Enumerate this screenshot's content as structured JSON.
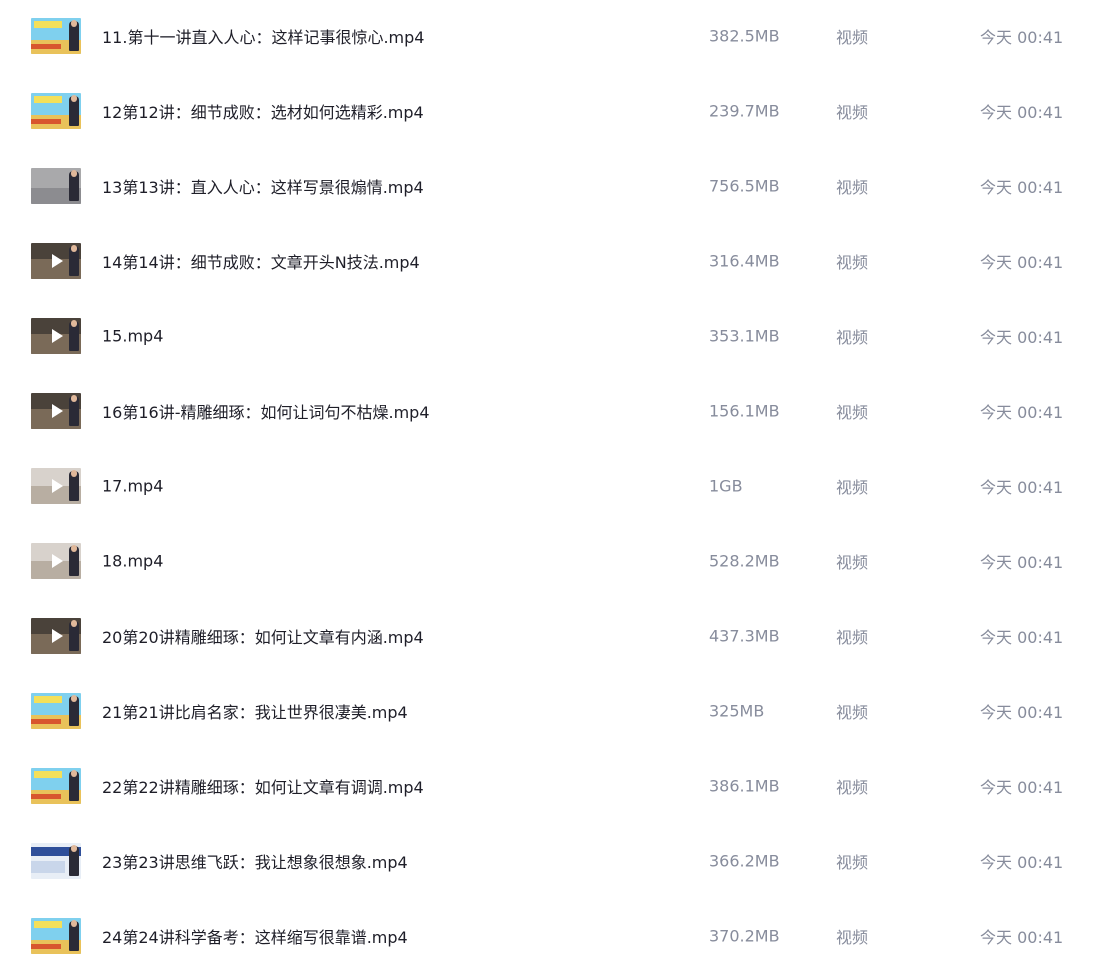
{
  "files": [
    {
      "name": "11.第十一讲直入人心：这样记事很惊心.mp4",
      "size": "382.5MB",
      "type": "视频",
      "time": "今天 00:41",
      "thumb": "cartoon"
    },
    {
      "name": "12第12讲：细节成败：选材如何选精彩.mp4",
      "size": "239.7MB",
      "type": "视频",
      "time": "今天 00:41",
      "thumb": "cartoon"
    },
    {
      "name": "13第13讲：直入人心：这样写景很煽情.mp4",
      "size": "756.5MB",
      "type": "视频",
      "time": "今天 00:41",
      "thumb": "gray"
    },
    {
      "name": "14第14讲：细节成败：文章开头N技法.mp4",
      "size": "316.4MB",
      "type": "视频",
      "time": "今天 00:41",
      "thumb": "dark-play"
    },
    {
      "name": "15.mp4",
      "size": "353.1MB",
      "type": "视频",
      "time": "今天 00:41",
      "thumb": "dark-play"
    },
    {
      "name": "16第16讲-精雕细琢：如何让词句不枯燥.mp4",
      "size": "156.1MB",
      "type": "视频",
      "time": "今天 00:41",
      "thumb": "dark-play"
    },
    {
      "name": "17.mp4",
      "size": "1GB",
      "type": "视频",
      "time": "今天 00:41",
      "thumb": "light-play"
    },
    {
      "name": "18.mp4",
      "size": "528.2MB",
      "type": "视频",
      "time": "今天 00:41",
      "thumb": "light-play"
    },
    {
      "name": "20第20讲精雕细琢：如何让文章有内涵.mp4",
      "size": "437.3MB",
      "type": "视频",
      "time": "今天 00:41",
      "thumb": "dark-play"
    },
    {
      "name": "21第21讲比肩名家：我让世界很凄美.mp4",
      "size": "325MB",
      "type": "视频",
      "time": "今天 00:41",
      "thumb": "cartoon"
    },
    {
      "name": "22第22讲精雕细琢：如何让文章有调调.mp4",
      "size": "386.1MB",
      "type": "视频",
      "time": "今天 00:41",
      "thumb": "cartoon"
    },
    {
      "name": "23第23讲思维飞跃：我让想象很想象.mp4",
      "size": "366.2MB",
      "type": "视频",
      "time": "今天 00:41",
      "thumb": "blue"
    },
    {
      "name": "24第24讲科学备考：这样缩写很靠谱.mp4",
      "size": "370.2MB",
      "type": "视频",
      "time": "今天 00:41",
      "thumb": "cartoon"
    }
  ],
  "colors": {
    "name_text": "#1e1e28",
    "meta_text": "#878c9c",
    "background": "#ffffff"
  }
}
